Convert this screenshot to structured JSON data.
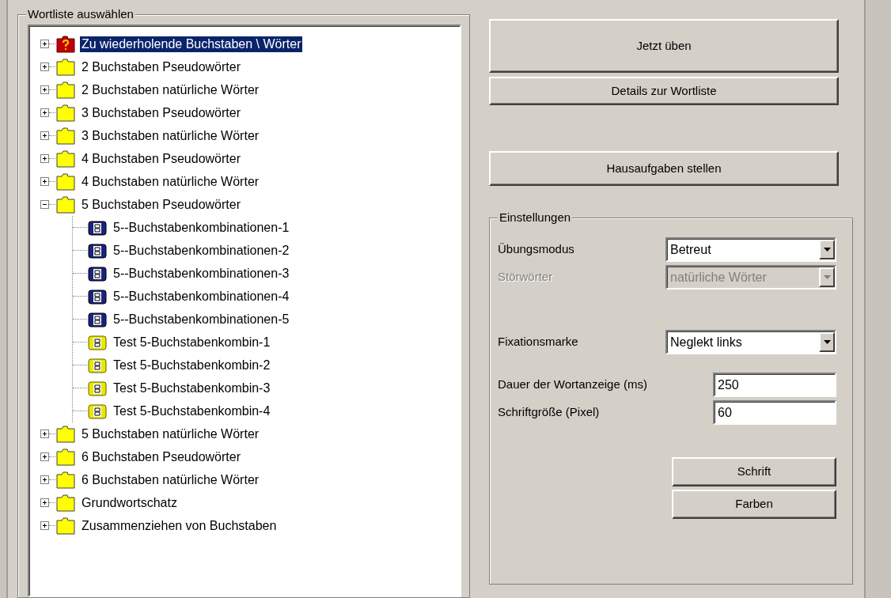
{
  "wordlist_group": {
    "title": "Wortliste auswählen",
    "tree": [
      {
        "label": "Zu wiederholende Buchstaben \\ Wörter",
        "kind": "review-folder",
        "expanded": false,
        "selected": true
      },
      {
        "label": "2 Buchstaben Pseudowörter",
        "kind": "folder",
        "expanded": false,
        "selected": false
      },
      {
        "label": "2 Buchstaben natürliche Wörter",
        "kind": "folder",
        "expanded": false,
        "selected": false
      },
      {
        "label": "3 Buchstaben Pseudowörter",
        "kind": "folder",
        "expanded": false,
        "selected": false
      },
      {
        "label": "3 Buchstaben natürliche Wörter",
        "kind": "folder",
        "expanded": false,
        "selected": false
      },
      {
        "label": "4 Buchstaben Pseudowörter",
        "kind": "folder",
        "expanded": false,
        "selected": false
      },
      {
        "label": "4 Buchstaben natürliche Wörter",
        "kind": "folder",
        "expanded": false,
        "selected": false
      },
      {
        "label": "5 Buchstaben Pseudowörter",
        "kind": "folder",
        "expanded": true,
        "selected": false,
        "children": [
          {
            "label": "5--Buchstabenkombinationen-1",
            "kind": "exercise",
            "selected": false
          },
          {
            "label": "5--Buchstabenkombinationen-2",
            "kind": "exercise",
            "selected": false
          },
          {
            "label": "5--Buchstabenkombinationen-3",
            "kind": "exercise",
            "selected": false
          },
          {
            "label": "5--Buchstabenkombinationen-4",
            "kind": "exercise",
            "selected": false
          },
          {
            "label": "5--Buchstabenkombinationen-5",
            "kind": "exercise",
            "selected": false
          },
          {
            "label": "Test 5-Buchstabenkombin-1",
            "kind": "test",
            "selected": false
          },
          {
            "label": "Test 5-Buchstabenkombin-2",
            "kind": "test",
            "selected": false
          },
          {
            "label": "Test 5-Buchstabenkombin-3",
            "kind": "test",
            "selected": false
          },
          {
            "label": "Test 5-Buchstabenkombin-4",
            "kind": "test",
            "selected": false
          }
        ]
      },
      {
        "label": "5 Buchstaben natürliche Wörter",
        "kind": "folder",
        "expanded": false,
        "selected": false
      },
      {
        "label": "6 Buchstaben Pseudowörter",
        "kind": "folder",
        "expanded": false,
        "selected": false
      },
      {
        "label": "6 Buchstaben natürliche Wörter",
        "kind": "folder",
        "expanded": false,
        "selected": false
      },
      {
        "label": "Grundwortschatz",
        "kind": "folder",
        "expanded": false,
        "selected": false
      },
      {
        "label": "Zusammenziehen von Buchstaben",
        "kind": "folder",
        "expanded": false,
        "selected": false
      }
    ]
  },
  "buttons": [
    "Jetzt üben",
    "Details zur Wortliste",
    "Hausaufgaben stellen"
  ],
  "settings": {
    "title": "Einstellungen",
    "fields": [
      {
        "label": "Übungsmodus",
        "kind": "dropdown",
        "value": "Betreut",
        "disabled": false
      },
      {
        "label": "Störwörter",
        "kind": "dropdown",
        "value": "natürliche Wörter",
        "disabled": true
      },
      {
        "label": "Fixationsmarke",
        "kind": "dropdown",
        "value": "Neglekt links",
        "disabled": false
      },
      {
        "label": "Dauer der Wortanzeige (ms)",
        "kind": "text",
        "value": "250",
        "disabled": false
      },
      {
        "label": "Schriftgröße (Pixel)",
        "kind": "text",
        "value": "60",
        "disabled": false
      }
    ],
    "buttons": [
      "Schrift",
      "Farben"
    ]
  }
}
